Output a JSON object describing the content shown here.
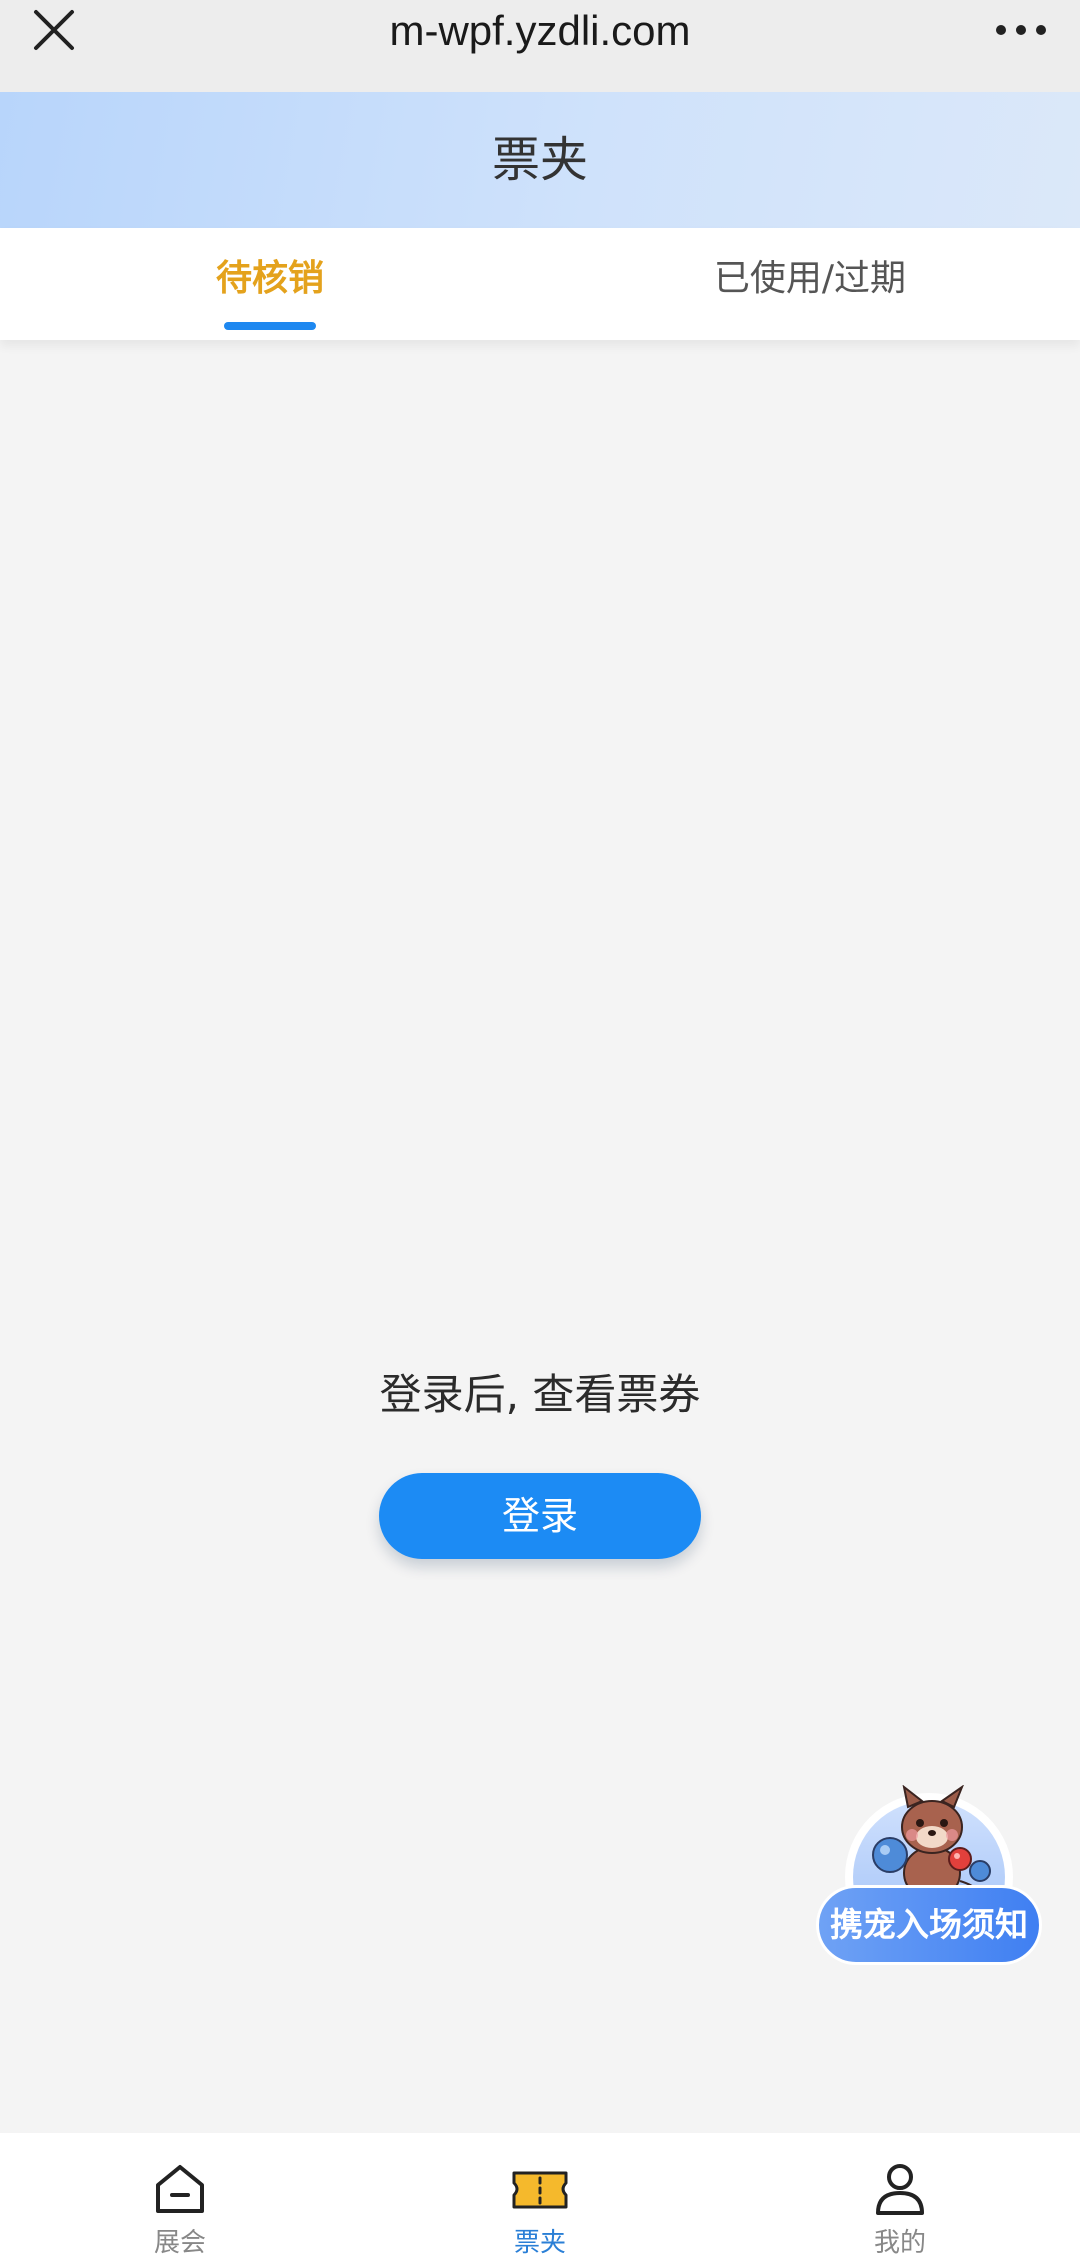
{
  "browser": {
    "url": "m-wpf.yzdli.com",
    "close_icon": "close-icon",
    "more_icon": "more-dots-icon"
  },
  "header": {
    "title": "票夹"
  },
  "tabs": [
    {
      "label": "待核销",
      "active": true
    },
    {
      "label": "已使用/过期",
      "active": false
    }
  ],
  "empty_state": {
    "message": "登录后, 查看票券",
    "login_label": "登录"
  },
  "floating_notice": {
    "label": "携宠入场须知",
    "icon": "pet-mascot-icon"
  },
  "bottom_nav": [
    {
      "label": "展会",
      "icon": "home-icon",
      "active": false
    },
    {
      "label": "票夹",
      "icon": "ticket-icon",
      "active": true
    },
    {
      "label": "我的",
      "icon": "user-icon",
      "active": false
    }
  ],
  "colors": {
    "accent_blue": "#1c8bf4",
    "active_tab": "#e4a21c",
    "header_gradient_start": "#b8d5fb",
    "ticket_icon_fill": "#f5b92c"
  }
}
